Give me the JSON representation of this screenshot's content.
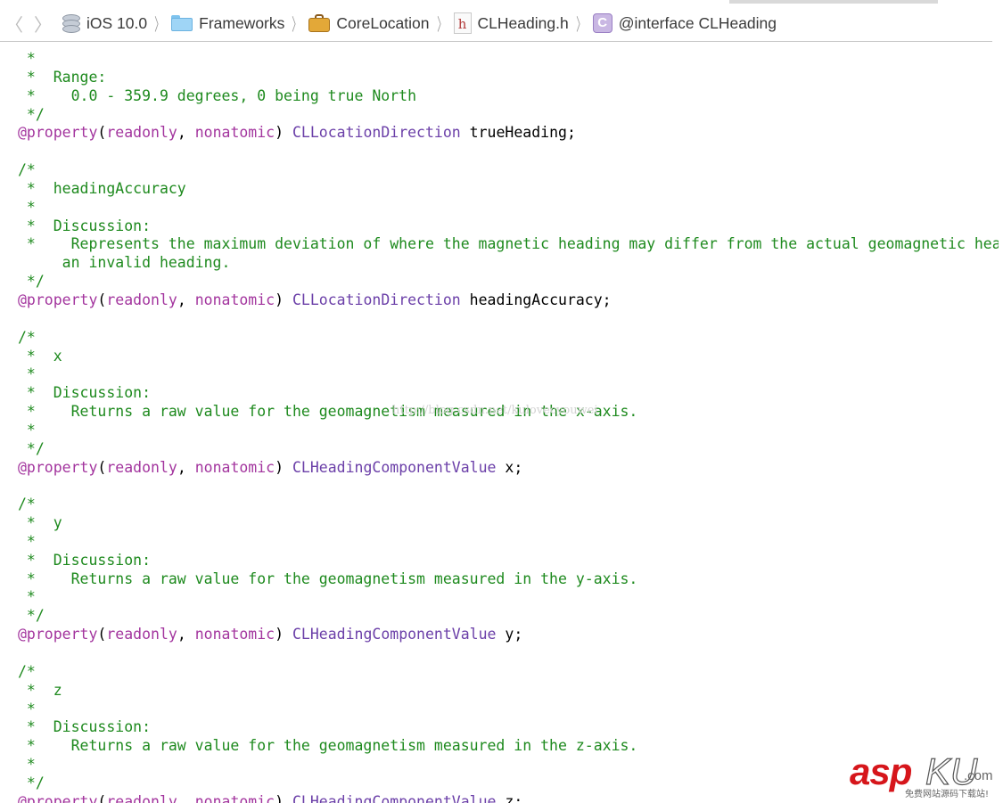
{
  "jumpbar": {
    "back_glyph": "〈",
    "forward_glyph": "〉",
    "separator": "〉",
    "crumbs": [
      {
        "label": "iOS 10.0",
        "icon": "sdk-icon"
      },
      {
        "label": "Frameworks",
        "icon": "folder-icon"
      },
      {
        "label": "CoreLocation",
        "icon": "framework-icon"
      },
      {
        "label": "CLHeading.h",
        "icon": "header-file-icon",
        "icon_glyph": "h"
      },
      {
        "label": "@interface CLHeading",
        "icon": "class-icon",
        "icon_glyph": "C"
      }
    ]
  },
  "colors": {
    "comment": "#1e8a1e",
    "keyword": "#a3359e",
    "type": "#6b3fa8",
    "plain": "#000000"
  },
  "code_lines": [
    [
      {
        "t": " *",
        "k": "comment"
      }
    ],
    [
      {
        "t": " *  Range:",
        "k": "comment"
      }
    ],
    [
      {
        "t": " *    0.0 - 359.9 degrees, 0 being true North",
        "k": "comment"
      }
    ],
    [
      {
        "t": " */",
        "k": "comment"
      }
    ],
    [
      {
        "t": "@property",
        "k": "keyword"
      },
      {
        "t": "(",
        "k": "plain"
      },
      {
        "t": "readonly",
        "k": "keyword"
      },
      {
        "t": ", ",
        "k": "plain"
      },
      {
        "t": "nonatomic",
        "k": "keyword"
      },
      {
        "t": ") ",
        "k": "plain"
      },
      {
        "t": "CLLocationDirection",
        "k": "type"
      },
      {
        "t": " trueHeading;",
        "k": "plain"
      }
    ],
    [],
    [
      {
        "t": "/*",
        "k": "comment"
      }
    ],
    [
      {
        "t": " *  headingAccuracy",
        "k": "comment"
      }
    ],
    [
      {
        "t": " *",
        "k": "comment"
      }
    ],
    [
      {
        "t": " *  Discussion:",
        "k": "comment"
      }
    ],
    [
      {
        "t": " *    Represents the maximum deviation of where the magnetic heading may differ from the actual geomagnetic heading in degrees. A negative value indicates",
        "k": "comment"
      }
    ],
    [
      {
        "t": "     an invalid heading.",
        "k": "comment"
      }
    ],
    [
      {
        "t": " */",
        "k": "comment"
      }
    ],
    [
      {
        "t": "@property",
        "k": "keyword"
      },
      {
        "t": "(",
        "k": "plain"
      },
      {
        "t": "readonly",
        "k": "keyword"
      },
      {
        "t": ", ",
        "k": "plain"
      },
      {
        "t": "nonatomic",
        "k": "keyword"
      },
      {
        "t": ") ",
        "k": "plain"
      },
      {
        "t": "CLLocationDirection",
        "k": "type"
      },
      {
        "t": " headingAccuracy;",
        "k": "plain"
      }
    ],
    [],
    [
      {
        "t": "/*",
        "k": "comment"
      }
    ],
    [
      {
        "t": " *  x",
        "k": "comment"
      }
    ],
    [
      {
        "t": " *",
        "k": "comment"
      }
    ],
    [
      {
        "t": " *  Discussion:",
        "k": "comment"
      }
    ],
    [
      {
        "t": " *    Returns a raw value for the geomagnetism measured in the x-axis.",
        "k": "comment"
      }
    ],
    [
      {
        "t": " *",
        "k": "comment"
      }
    ],
    [
      {
        "t": " */",
        "k": "comment"
      }
    ],
    [
      {
        "t": "@property",
        "k": "keyword"
      },
      {
        "t": "(",
        "k": "plain"
      },
      {
        "t": "readonly",
        "k": "keyword"
      },
      {
        "t": ", ",
        "k": "plain"
      },
      {
        "t": "nonatomic",
        "k": "keyword"
      },
      {
        "t": ") ",
        "k": "plain"
      },
      {
        "t": "CLHeadingComponentValue",
        "k": "type"
      },
      {
        "t": " x;",
        "k": "plain"
      }
    ],
    [],
    [
      {
        "t": "/*",
        "k": "comment"
      }
    ],
    [
      {
        "t": " *  y",
        "k": "comment"
      }
    ],
    [
      {
        "t": " *",
        "k": "comment"
      }
    ],
    [
      {
        "t": " *  Discussion:",
        "k": "comment"
      }
    ],
    [
      {
        "t": " *    Returns a raw value for the geomagnetism measured in the y-axis.",
        "k": "comment"
      }
    ],
    [
      {
        "t": " *",
        "k": "comment"
      }
    ],
    [
      {
        "t": " */",
        "k": "comment"
      }
    ],
    [
      {
        "t": "@property",
        "k": "keyword"
      },
      {
        "t": "(",
        "k": "plain"
      },
      {
        "t": "readonly",
        "k": "keyword"
      },
      {
        "t": ", ",
        "k": "plain"
      },
      {
        "t": "nonatomic",
        "k": "keyword"
      },
      {
        "t": ") ",
        "k": "plain"
      },
      {
        "t": "CLHeadingComponentValue",
        "k": "type"
      },
      {
        "t": " y;",
        "k": "plain"
      }
    ],
    [],
    [
      {
        "t": "/*",
        "k": "comment"
      }
    ],
    [
      {
        "t": " *  z",
        "k": "comment"
      }
    ],
    [
      {
        "t": " *",
        "k": "comment"
      }
    ],
    [
      {
        "t": " *  Discussion:",
        "k": "comment"
      }
    ],
    [
      {
        "t": " *    Returns a raw value for the geomagnetism measured in the z-axis.",
        "k": "comment"
      }
    ],
    [
      {
        "t": " *",
        "k": "comment"
      }
    ],
    [
      {
        "t": " */",
        "k": "comment"
      }
    ],
    [
      {
        "t": "@property",
        "k": "keyword"
      },
      {
        "t": "(",
        "k": "plain"
      },
      {
        "t": "readonly",
        "k": "keyword"
      },
      {
        "t": ", ",
        "k": "plain"
      },
      {
        "t": "nonatomic",
        "k": "keyword"
      },
      {
        "t": ") ",
        "k": "plain"
      },
      {
        "t": "CLHeadingComponentValue",
        "k": "type"
      },
      {
        "t": " z;",
        "k": "plain"
      }
    ]
  ],
  "watermark": {
    "text": "http://blog.csdn.net/kulovecyouwei"
  },
  "logo": {
    "main": "asp",
    "ku": "KU",
    "com": ".com",
    "sub": "免费网站源码下载站!"
  }
}
